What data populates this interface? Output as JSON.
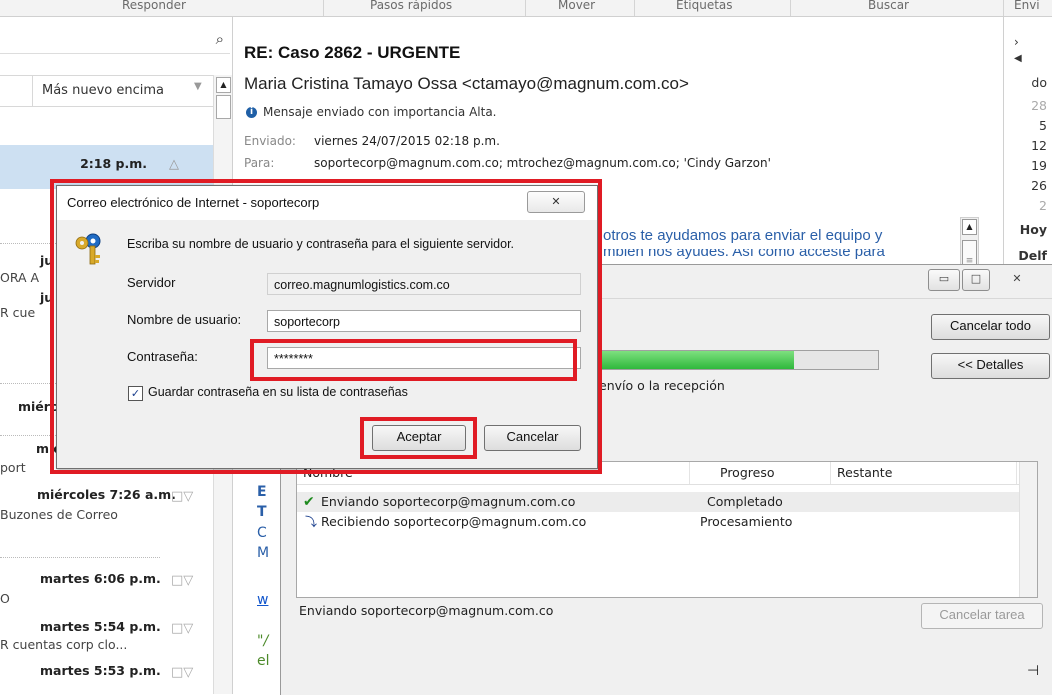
{
  "ribbon": {
    "groups": [
      "Responder",
      "Pasos rápidos",
      "Mover",
      "Etiquetas",
      "Buscar",
      "Envi"
    ]
  },
  "message_list": {
    "sort_label": "Más nuevo encima",
    "items": [
      {
        "time": "2:18 p.m.",
        "subject": ""
      },
      {
        "time": "ju",
        "subject": "ORA A"
      },
      {
        "time": "ju",
        "subject": "R cue"
      },
      {
        "time": "miérc",
        "subject": ""
      },
      {
        "time": "mié",
        "subject": "port"
      },
      {
        "time": "miércoles 7:26 a.m.",
        "subject": "Buzones de Correo"
      },
      {
        "time": "martes 6:06 p.m.",
        "subject": "O"
      },
      {
        "time": "martes 5:54 p.m.",
        "subject": "R cuentas corp clo..."
      },
      {
        "time": "martes 5:53 p.m.",
        "subject": ""
      }
    ]
  },
  "reading_pane": {
    "subject": "RE: Caso 2862 - URGENTE",
    "sender": "Maria Cristina Tamayo Ossa <ctamayo@magnum.com.co>",
    "importance": "Mensaje enviado con importancia Alta.",
    "sent_label": "Enviado:",
    "sent_value": "viernes 24/07/2015 02:18 p.m.",
    "to_label": "Para:",
    "to_value": "soportecorp@magnum.com.co; mtrochez@magnum.com.co; 'Cindy Garzon'",
    "body_line1": "otros te ayudamos para enviar el equipo y",
    "body_line2": "mbién nos ayudes. Así como acceste para",
    "body_frag_e": "E",
    "body_frag_t": "T",
    "body_frag_c": "C",
    "body_frag_m": "M",
    "body_frag_w": "w",
    "body_frag_q": "\"/",
    "body_frag_el": "el"
  },
  "calendar": {
    "day_label": "do",
    "days": [
      "28",
      "5",
      "12",
      "19",
      "26",
      "2"
    ],
    "today": "Hoy",
    "next": "Delf"
  },
  "progress_dialog": {
    "cancel_all": "Cancelar todo",
    "details": "<< Detalles",
    "status_text": "envío o la recepción",
    "progress": 0.7,
    "columns": [
      "Nombre",
      "Progreso",
      "Restante"
    ],
    "tasks": [
      {
        "name": "Enviando soportecorp@magnum.com.co",
        "progress": "Completado",
        "remaining": ""
      },
      {
        "name": "Recibiendo soportecorp@magnum.com.co",
        "progress": "Procesamiento",
        "remaining": ""
      }
    ],
    "footer_status": "Enviando soportecorp@magnum.com.co",
    "cancel_task": "Cancelar tarea"
  },
  "password_dialog": {
    "title": "Correo electrónico de Internet - soportecorp",
    "close": "X",
    "prompt": "Escriba su nombre de usuario y contraseña para el siguiente servidor.",
    "server_label": "Servidor",
    "server_value": "correo.magnumlogistics.com.co",
    "username_label": "Nombre de usuario:",
    "username_value": "soportecorp",
    "password_label": "Contraseña:",
    "password_value": "********",
    "remember_label": "Guardar contraseña en su lista de contraseñas",
    "remember_checked": true,
    "ok": "Aceptar",
    "cancel": "Cancelar"
  },
  "colors": {
    "highlight": "#e01b24",
    "progress_fill": "#37c545",
    "link": "#1155cc",
    "body_text": "#2a5fa8"
  }
}
